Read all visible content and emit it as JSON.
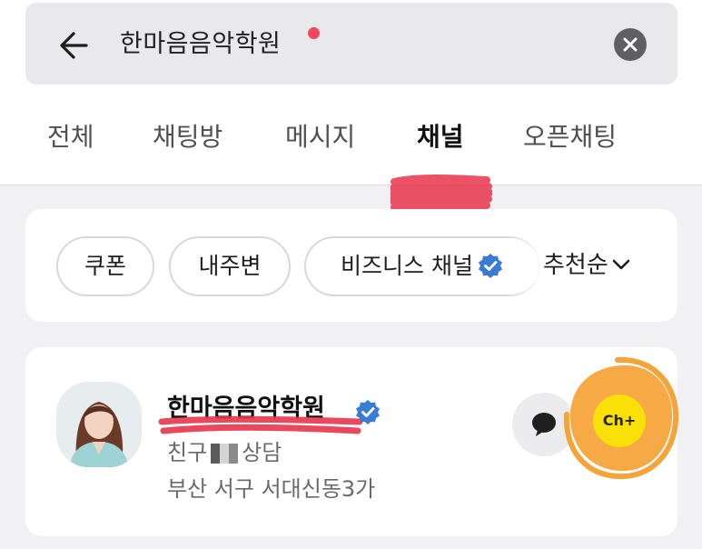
{
  "search": {
    "query": "한마음음악학원"
  },
  "tabs": [
    {
      "label": "전체",
      "active": false
    },
    {
      "label": "채팅방",
      "active": false
    },
    {
      "label": "메시지",
      "active": false
    },
    {
      "label": "채널",
      "active": true
    },
    {
      "label": "오픈채팅",
      "active": false
    }
  ],
  "filters": {
    "chips": [
      "쿠폰",
      "내주변",
      "비즈니스 채널"
    ],
    "sort_label": "추천순"
  },
  "result": {
    "name": "한마음음악학원",
    "sub_prefix": "친구",
    "sub_suffix": "상담",
    "address": "부산 서구 서대신동3가",
    "add_button_label": "Ch+"
  },
  "colors": {
    "accent_yellow": "#f8e008",
    "verified_blue": "#3a7bd5",
    "notification_red": "#f0485c",
    "annotation_red": "#e8344a",
    "annotation_orange": "#f5a43a"
  }
}
